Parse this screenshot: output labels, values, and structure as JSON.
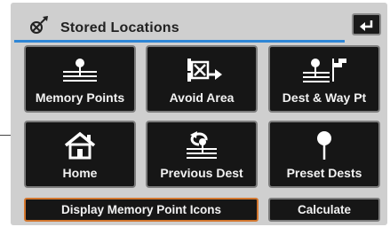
{
  "title": "Stored Locations",
  "icons": {
    "title": "stored-locations-icon",
    "back": "return-arrow-icon"
  },
  "tiles": [
    {
      "label": "Memory Points",
      "icon": "memory-points-icon"
    },
    {
      "label": "Avoid Area",
      "icon": "avoid-area-icon"
    },
    {
      "label": "Dest & Way Pt",
      "icon": "dest-waypoint-icon"
    },
    {
      "label": "Home",
      "icon": "home-icon"
    },
    {
      "label": "Previous Dest",
      "icon": "previous-dest-icon"
    },
    {
      "label": "Preset Dests",
      "icon": "preset-dests-icon"
    }
  ],
  "bottom": {
    "display_label": "Display Memory Point Icons",
    "calculate_label": "Calculate"
  },
  "colors": {
    "title_underline": "#2e86d6",
    "selected_border": "#d3772f"
  }
}
